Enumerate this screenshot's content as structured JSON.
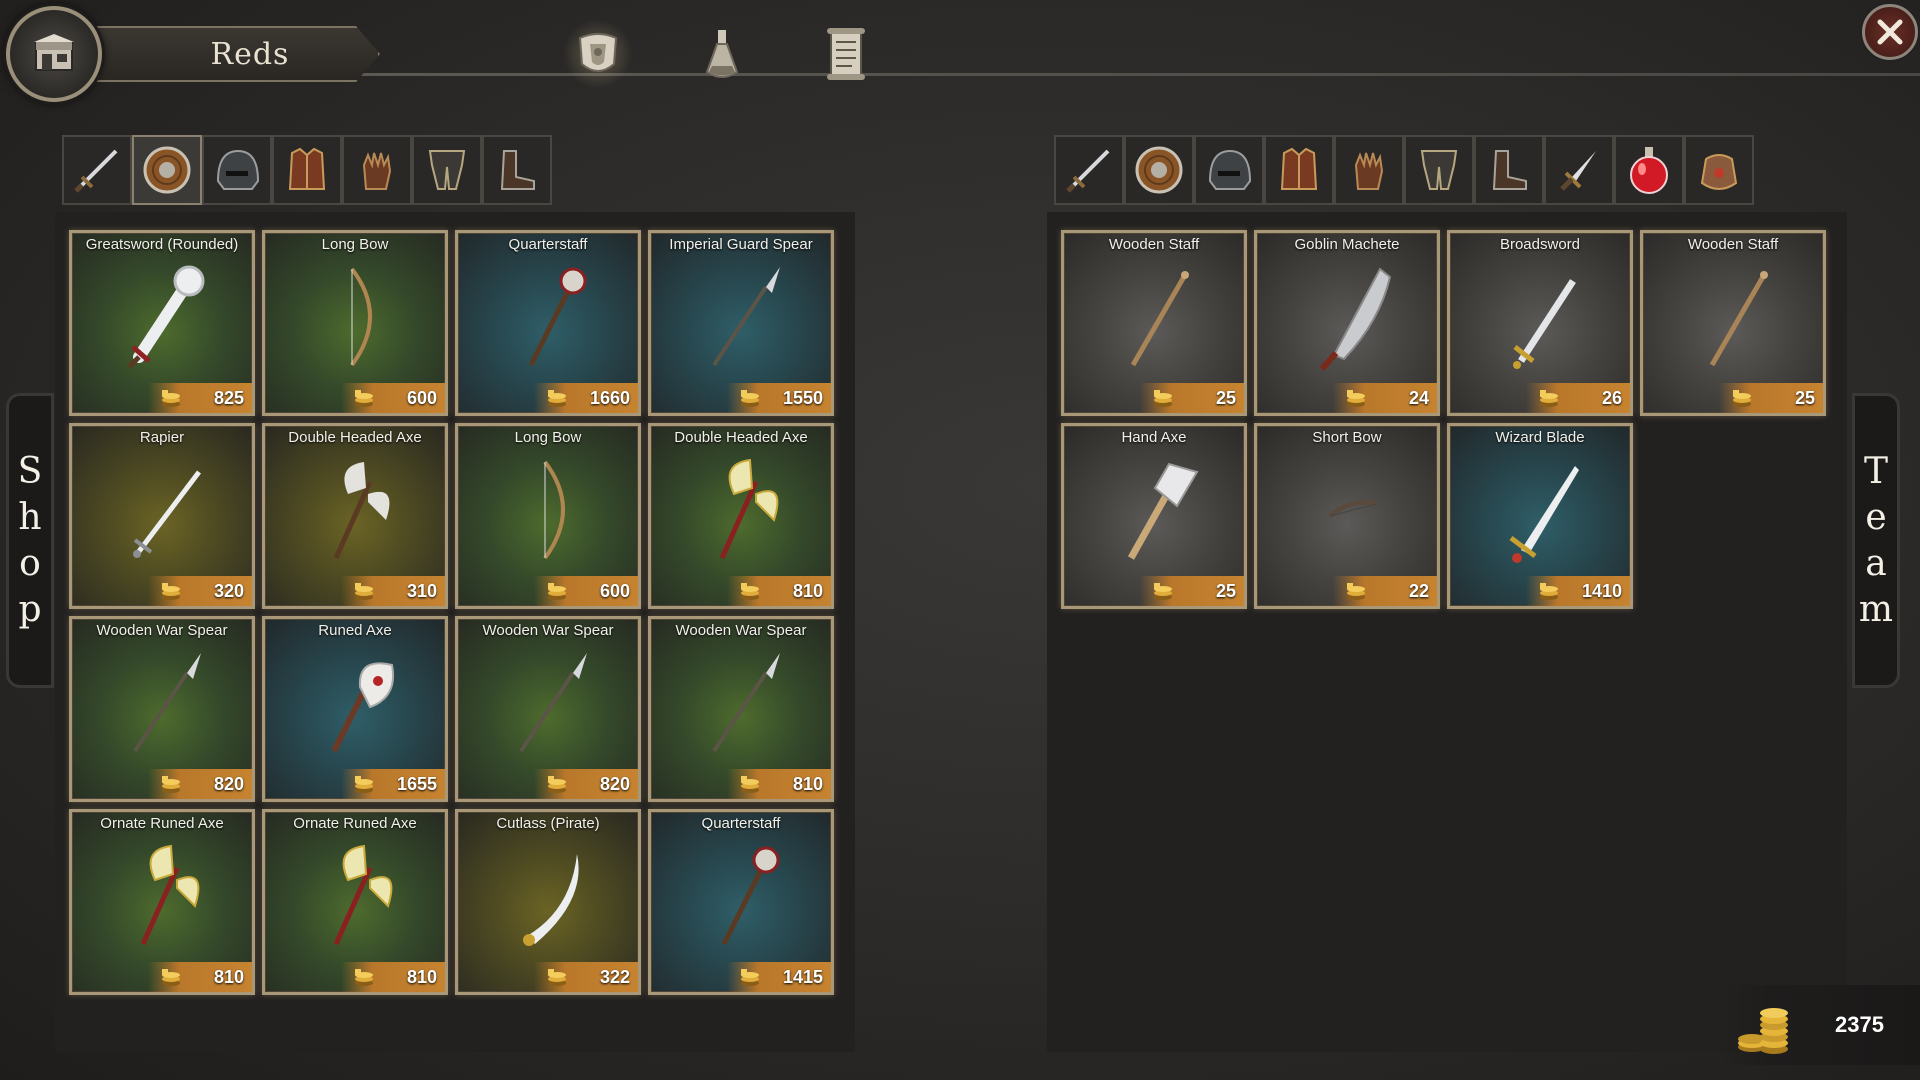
{
  "header": {
    "team_name": "Reds"
  },
  "top_tabs": [
    {
      "name": "equipment-tab",
      "icon": "armor-crest-icon",
      "active": true
    },
    {
      "name": "potions-tab",
      "icon": "flask-icon",
      "active": false
    },
    {
      "name": "scroll-tab",
      "icon": "scroll-icon",
      "active": false
    }
  ],
  "shop": {
    "side_label": "Shop",
    "categories": [
      {
        "icon": "sword-icon",
        "active": false
      },
      {
        "icon": "shield-icon",
        "active": true
      },
      {
        "icon": "helmet-icon",
        "active": false
      },
      {
        "icon": "chest-armor-icon",
        "active": false
      },
      {
        "icon": "gloves-icon",
        "active": false
      },
      {
        "icon": "leg-armor-icon",
        "active": false
      },
      {
        "icon": "boots-icon",
        "active": false
      }
    ],
    "items": [
      {
        "name": "Greatsword (Rounded)",
        "price": "825",
        "bg": "green",
        "art": "greatsword"
      },
      {
        "name": "Long Bow",
        "price": "600",
        "bg": "green",
        "art": "bow"
      },
      {
        "name": "Quarterstaff",
        "price": "1660",
        "bg": "teal",
        "art": "mace-staff"
      },
      {
        "name": "Imperial Guard Spear",
        "price": "1550",
        "bg": "teal",
        "art": "spear"
      },
      {
        "name": "Rapier",
        "price": "320",
        "bg": "gold",
        "art": "rapier"
      },
      {
        "name": "Double Headed Axe",
        "price": "310",
        "bg": "gold",
        "art": "double-axe"
      },
      {
        "name": "Long Bow",
        "price": "600",
        "bg": "green",
        "art": "bow"
      },
      {
        "name": "Double Headed Axe",
        "price": "810",
        "bg": "green",
        "art": "double-axe-gold"
      },
      {
        "name": "Wooden War Spear",
        "price": "820",
        "bg": "green",
        "art": "spear"
      },
      {
        "name": "Runed Axe",
        "price": "1655",
        "bg": "teal",
        "art": "runed-axe"
      },
      {
        "name": "Wooden War Spear",
        "price": "820",
        "bg": "green",
        "art": "spear"
      },
      {
        "name": "Wooden War Spear",
        "price": "810",
        "bg": "green",
        "art": "spear"
      },
      {
        "name": "Ornate Runed Axe",
        "price": "810",
        "bg": "green",
        "art": "double-axe-gold"
      },
      {
        "name": "Ornate Runed Axe",
        "price": "810",
        "bg": "green",
        "art": "double-axe-gold"
      },
      {
        "name": "Cutlass (Pirate)",
        "price": "322",
        "bg": "gold",
        "art": "cutlass"
      },
      {
        "name": "Quarterstaff",
        "price": "1415",
        "bg": "teal",
        "art": "mace-staff"
      }
    ]
  },
  "team": {
    "side_label": "Team",
    "categories": [
      {
        "icon": "sword-icon",
        "active": false
      },
      {
        "icon": "shield-icon",
        "active": false
      },
      {
        "icon": "helmet-icon",
        "active": false
      },
      {
        "icon": "chest-armor-icon",
        "active": false
      },
      {
        "icon": "gloves-icon",
        "active": false
      },
      {
        "icon": "leg-armor-icon",
        "active": false
      },
      {
        "icon": "boots-icon",
        "active": false
      },
      {
        "icon": "dagger-icon",
        "active": false
      },
      {
        "icon": "health-potion-icon",
        "active": false
      },
      {
        "icon": "pouch-icon",
        "active": false
      }
    ],
    "items": [
      {
        "name": "Wooden Staff",
        "price": "25",
        "bg": "grey",
        "art": "staff"
      },
      {
        "name": "Goblin Machete",
        "price": "24",
        "bg": "grey",
        "art": "machete"
      },
      {
        "name": "Broadsword",
        "price": "26",
        "bg": "grey",
        "art": "broadsword"
      },
      {
        "name": "Wooden Staff",
        "price": "25",
        "bg": "grey",
        "art": "staff"
      },
      {
        "name": "Hand Axe",
        "price": "25",
        "bg": "grey",
        "art": "hand-axe"
      },
      {
        "name": "Short Bow",
        "price": "22",
        "bg": "grey",
        "art": "short-bow"
      },
      {
        "name": "Wizard Blade",
        "price": "1410",
        "bg": "teal",
        "art": "wizard-blade"
      }
    ]
  },
  "gold": {
    "amount": "2375",
    "icon": "gold-coins-icon"
  }
}
